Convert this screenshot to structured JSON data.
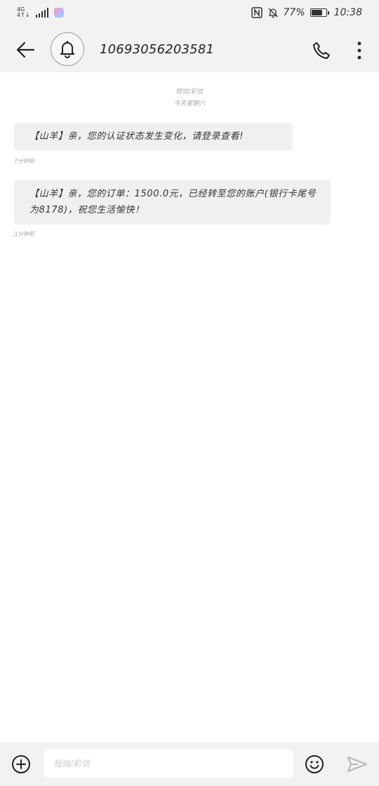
{
  "status_bar": {
    "network_type": "4G",
    "network_sub": "4↑↓",
    "battery_percent": "77%",
    "battery_level": 0.77,
    "time": "10:38",
    "icons": [
      "signal-icon",
      "app-notification-icon",
      "nfc-icon",
      "bell-off-icon",
      "battery-icon"
    ]
  },
  "header": {
    "contact_number": "10693056203581",
    "icons": [
      "back-arrow-icon",
      "bell-icon",
      "phone-icon",
      "more-vertical-icon"
    ]
  },
  "conversation": {
    "thread_label": "短信/彩信",
    "thread_sub": "今天星期六",
    "messages": [
      {
        "text": "【山羊】亲，您的认证状态发生变化，请登录查看!",
        "time": "7分钟前"
      },
      {
        "text": "【山羊】亲，您的订单：1500.0元，已经转至您的账户(银行卡尾号为8178)，祝您生活愉快！",
        "time": "3分钟前"
      }
    ]
  },
  "input_bar": {
    "placeholder": "短信/彩信",
    "value": "",
    "icons": [
      "add-circle-icon",
      "emoji-icon",
      "send-icon"
    ]
  },
  "colors": {
    "bar_background": "#f2f2f2",
    "bubble_background": "#f0f0f0",
    "text_primary": "#222222",
    "text_muted": "#a8a8a8"
  }
}
